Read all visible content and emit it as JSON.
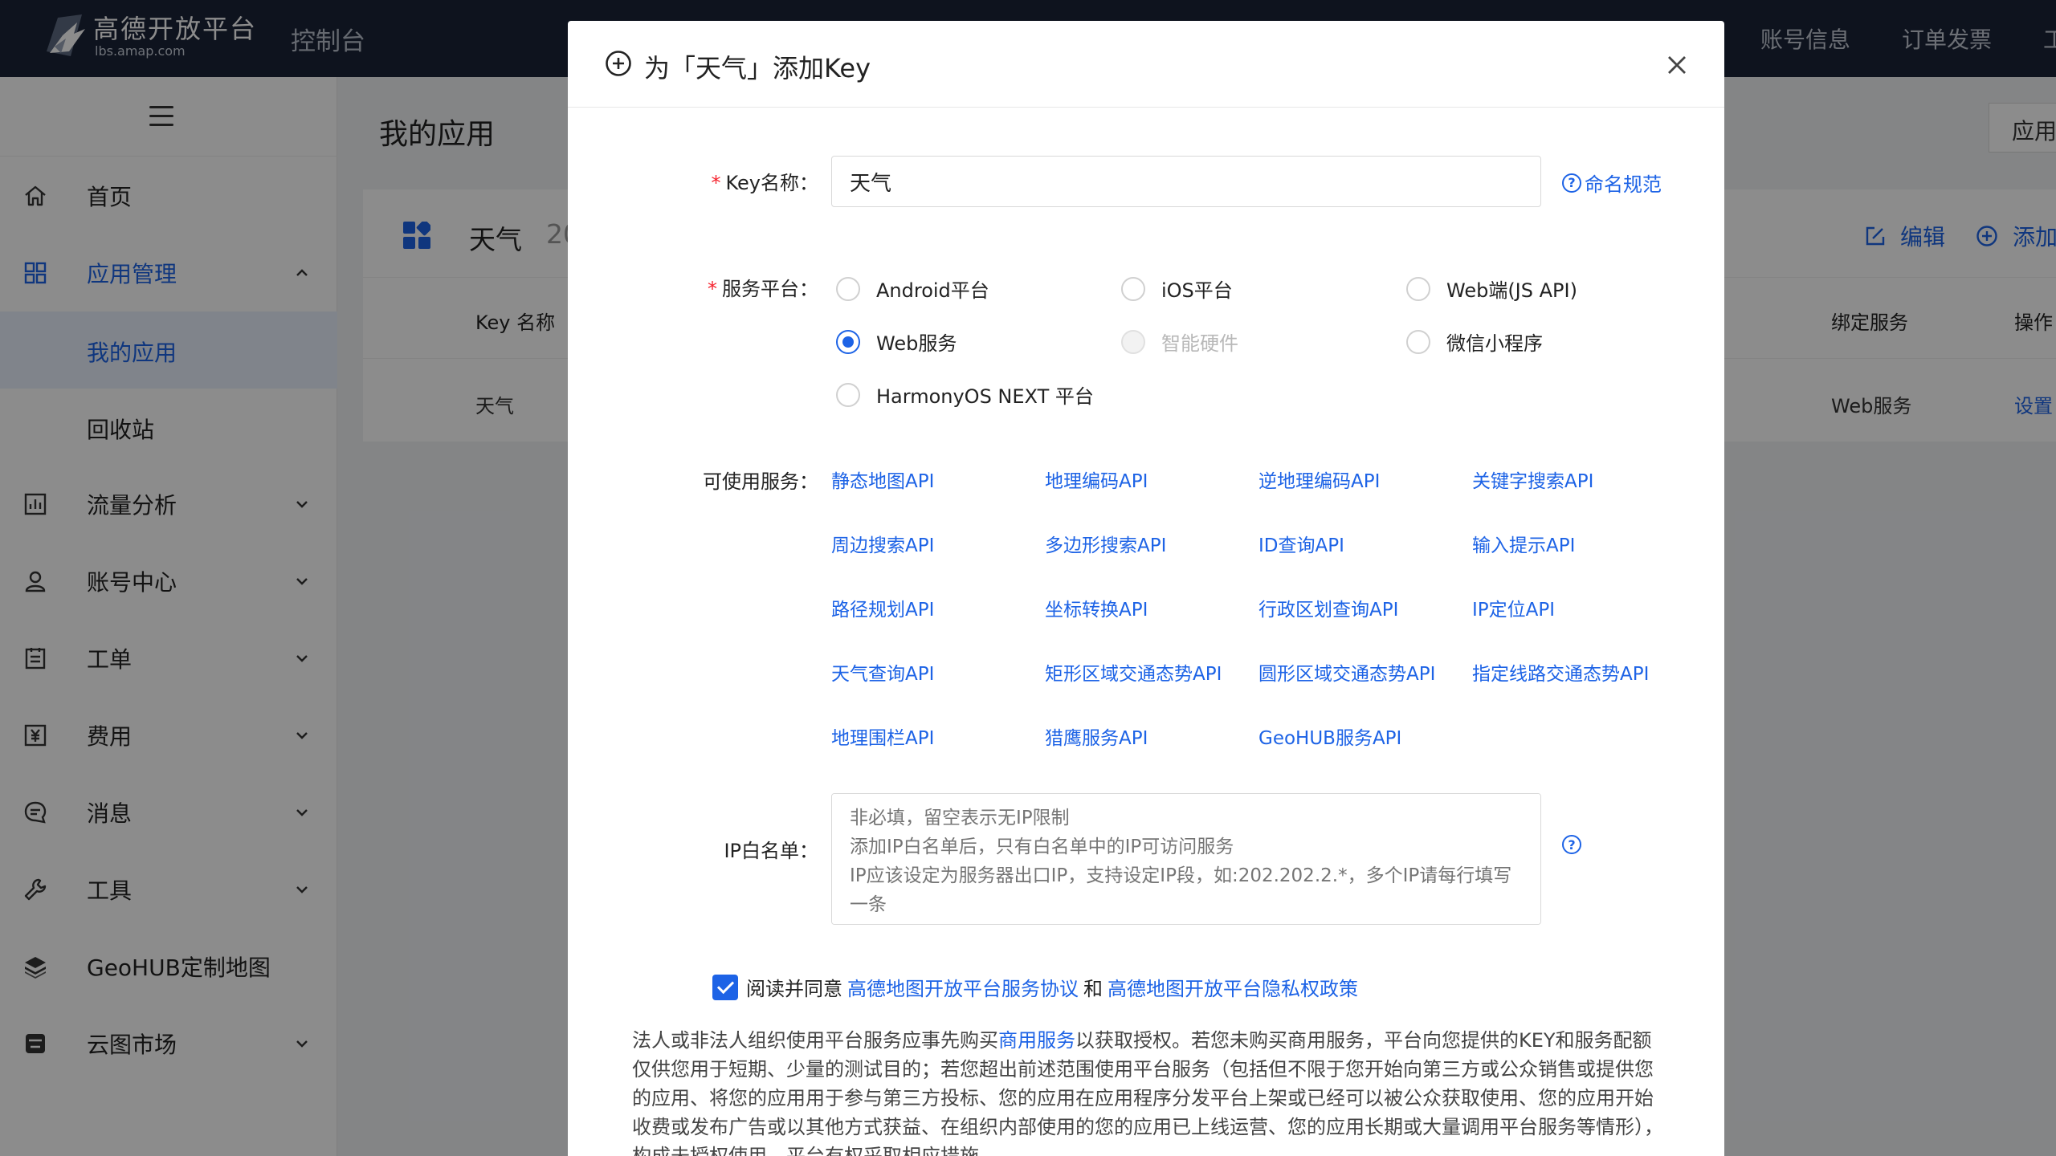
{
  "header": {
    "logo_cn": "高德开放平台",
    "logo_en": "lbs.amap.com",
    "console": "控制台",
    "account_info": "账号信息",
    "order_invoice": "订单发票",
    "cut_item": "工"
  },
  "sidebar": {
    "items": [
      {
        "label": "首页",
        "icon": "home-icon"
      },
      {
        "label": "应用管理",
        "icon": "grid-icon"
      },
      {
        "label": "我的应用"
      },
      {
        "label": "回收站"
      },
      {
        "label": "流量分析",
        "icon": "chart-icon"
      },
      {
        "label": "账号中心",
        "icon": "user-icon"
      },
      {
        "label": "工单",
        "icon": "ticket-icon"
      },
      {
        "label": "费用",
        "icon": "yen-icon"
      },
      {
        "label": "消息",
        "icon": "message-icon"
      },
      {
        "label": "工具",
        "icon": "wrench-icon"
      },
      {
        "label": "GeoHUB定制地图",
        "icon": "layers-icon"
      },
      {
        "label": "云图市场",
        "icon": "shop-icon"
      }
    ]
  },
  "main": {
    "page_title": "我的应用",
    "app_button": "应用",
    "card": {
      "name": "天气",
      "date_partial": "20",
      "edit": "编辑",
      "add": "添加",
      "columns": [
        "Key 名称",
        "绑定服务",
        "操作"
      ],
      "row": {
        "key_name": "天气",
        "service": "Web服务",
        "action": "设置"
      }
    }
  },
  "modal": {
    "title": "为「天气」添加Key",
    "key_name_label": "Key名称：",
    "key_name_value": "天气",
    "naming_rule": "命名规范",
    "platform_label": "服务平台：",
    "platforms": [
      {
        "label": "Android平台",
        "state": "unchecked"
      },
      {
        "label": "iOS平台",
        "state": "unchecked"
      },
      {
        "label": "Web端(JS API)",
        "state": "unchecked"
      },
      {
        "label": "Web服务",
        "state": "checked"
      },
      {
        "label": "智能硬件",
        "state": "disabled"
      },
      {
        "label": "微信小程序",
        "state": "unchecked"
      },
      {
        "label": "HarmonyOS NEXT 平台",
        "state": "unchecked"
      }
    ],
    "services_label": "可使用服务：",
    "services": [
      "静态地图API",
      "地理编码API",
      "逆地理编码API",
      "关键字搜索API",
      "周边搜索API",
      "多边形搜索API",
      "ID查询API",
      "输入提示API",
      "路径规划API",
      "坐标转换API",
      "行政区划查询API",
      "IP定位API",
      "天气查询API",
      "矩形区域交通态势API",
      "圆形区域交通态势API",
      "指定线路交通态势API",
      "地理围栏API",
      "猎鹰服务API",
      "GeoHUB服务API"
    ],
    "ip_label": "IP白名单：",
    "ip_placeholder": "非必填，留空表示无IP限制\n添加IP白名单后，只有白名单中的IP可访问服务\nIP应该设定为服务器出口IP，支持设定IP段，如:202.202.2.*，多个IP请每行填写一条",
    "agree_text": "阅读并同意",
    "agree_link1": "高德地图开放平台服务协议",
    "agree_and": "和",
    "agree_link2": "高德地图开放平台隐私权政策",
    "notice_pre": "法人或非法人组织使用平台服务应事先购买",
    "notice_link": "商用服务",
    "notice_post": "以获取授权。若您未购买商用服务，平台向您提供的KEY和服务配额仅供您用于短期、少量的测试目的；若您超出前述范围使用平台服务（包括但不限于您开始向第三方或公众销售或提供您的应用、将您的应用用于参与第三方投标、您的应用在应用程序分发平台上架或已经可以被公众获取使用、您的应用开始收费或发布广告或以其他方式获益、在组织内部使用的您的应用已上线运营、您的应用长期或大量调用平台服务等情形），构成未授权使用，平台有权采取相应措施。"
  },
  "colors": {
    "accent": "#1d63e6",
    "header_bg": "#1b2438",
    "required": "#f5222d"
  }
}
